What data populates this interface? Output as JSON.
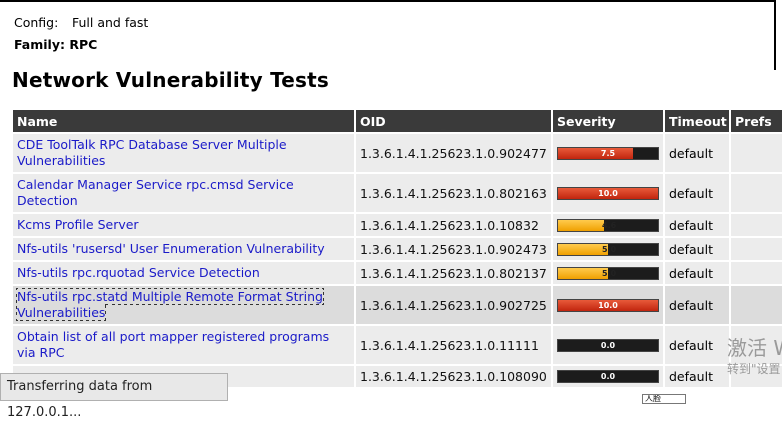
{
  "config": {
    "label": "Config:",
    "value": "Full and fast"
  },
  "family": {
    "label": "Family:",
    "value": "RPC"
  },
  "title": "Network Vulnerability Tests",
  "headers": {
    "name": "Name",
    "oid": "OID",
    "severity": "Severity",
    "timeout": "Timeout",
    "prefs": "Prefs"
  },
  "rows": [
    {
      "name": "CDE ToolTalk RPC Database Server Multiple Vulnerabilities",
      "oid": "1.3.6.1.4.1.25623.1.0.902477",
      "severity": "7.5",
      "timeout": "default"
    },
    {
      "name": "Calendar Manager Service rpc.cmsd Service Detection",
      "oid": "1.3.6.1.4.1.25623.1.0.802163",
      "severity": "10.0",
      "timeout": "default"
    },
    {
      "name": "Kcms Profile Server",
      "oid": "1.3.6.1.4.1.25623.1.0.10832",
      "severity": "4.6",
      "timeout": "default"
    },
    {
      "name": "Nfs-utils 'rusersd' User Enumeration Vulnerability",
      "oid": "1.3.6.1.4.1.25623.1.0.902473",
      "severity": "5.0",
      "timeout": "default"
    },
    {
      "name": "Nfs-utils rpc.rquotad Service Detection",
      "oid": "1.3.6.1.4.1.25623.1.0.802137",
      "severity": "5.0",
      "timeout": "default"
    },
    {
      "name": "Nfs-utils rpc.statd Multiple Remote Format String Vulnerabilities",
      "oid": "1.3.6.1.4.1.25623.1.0.902725",
      "severity": "10.0",
      "timeout": "default"
    },
    {
      "name": "Obtain list of all port mapper registered programs via RPC",
      "oid": "1.3.6.1.4.1.25623.1.0.11111",
      "severity": "0.0",
      "timeout": "default"
    },
    {
      "name": "",
      "oid": "1.3.6.1.4.1.25623.1.0.108090",
      "severity": "0.0",
      "timeout": "default"
    }
  ],
  "severity_colors": {
    "high": "#c1250e",
    "medium": "#f0a000",
    "none": "#1c1c1c"
  },
  "status_bar": "Transferring data from 127.0.0.1...",
  "watermark": {
    "line1": "激活 W",
    "line2": "转到\"设置"
  },
  "tooltip": "人脸"
}
